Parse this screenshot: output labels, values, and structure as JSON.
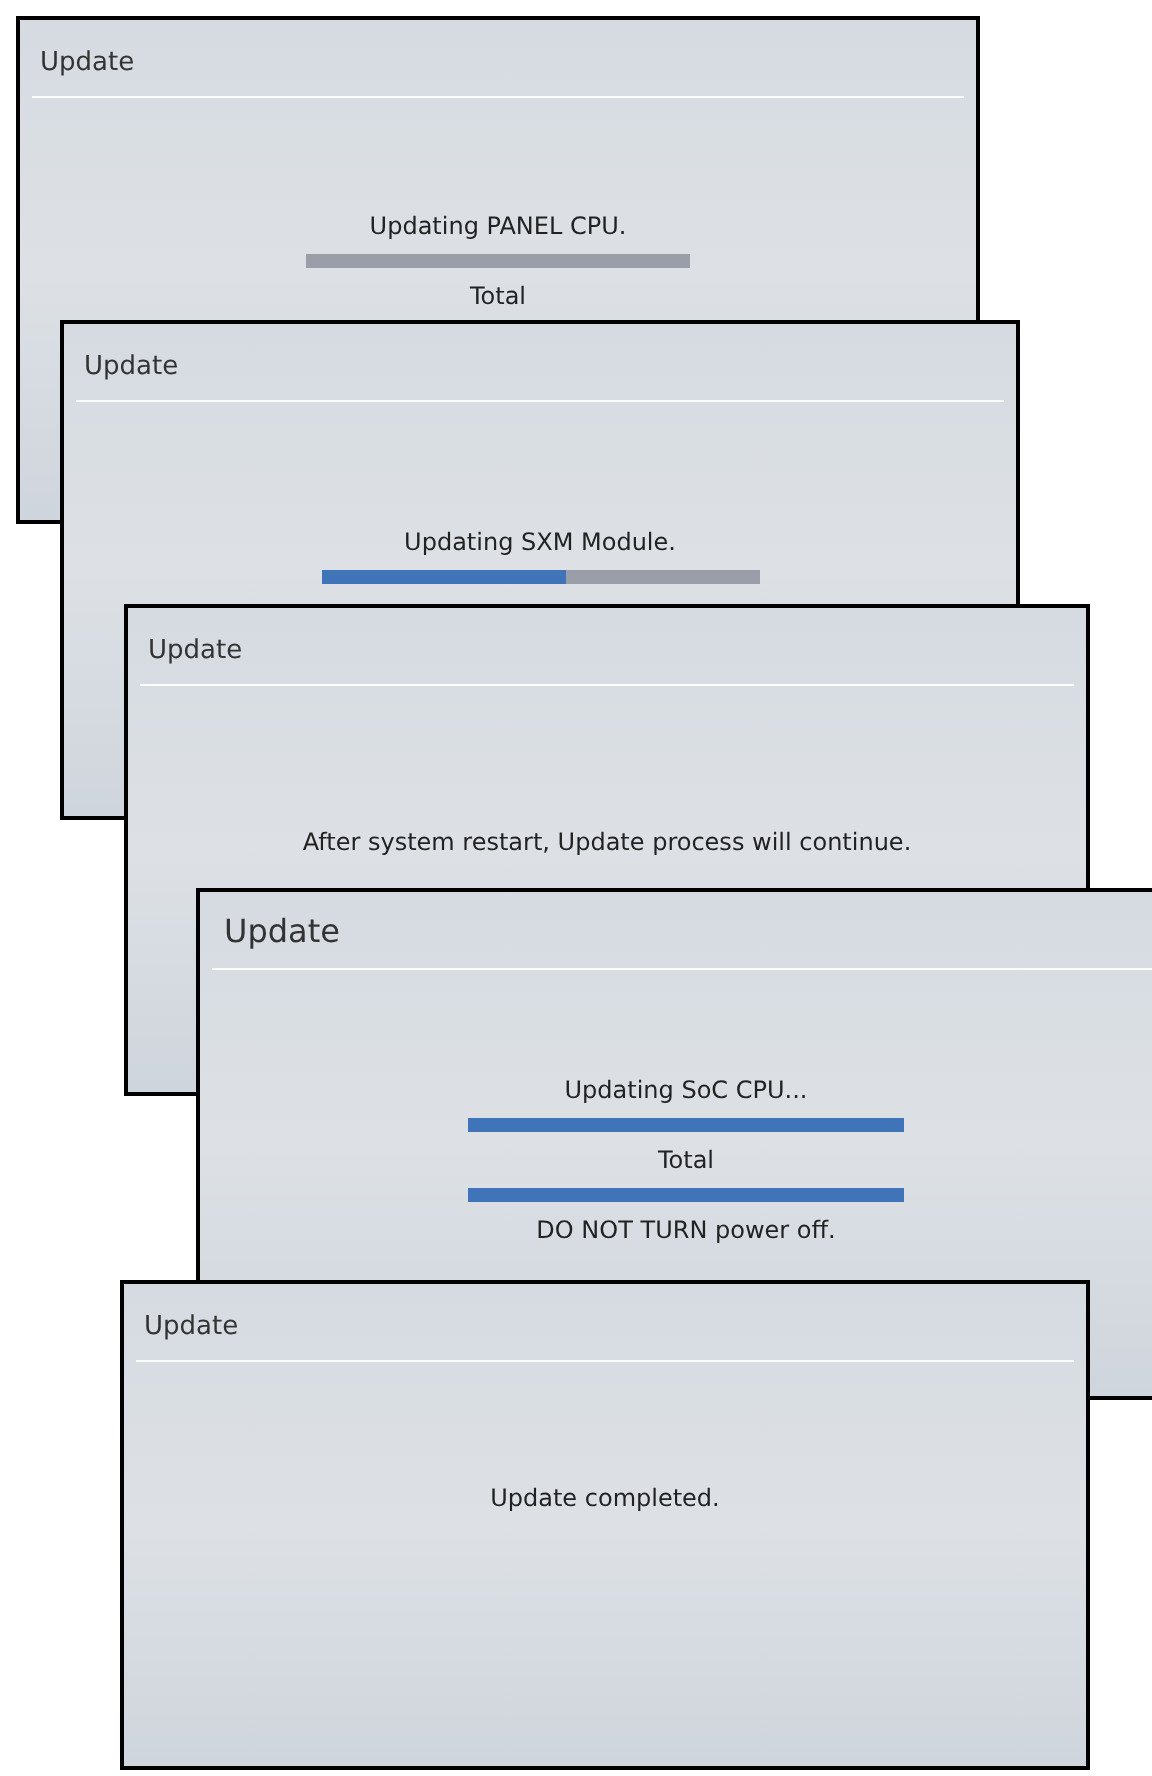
{
  "screens": [
    {
      "title": "Update",
      "items": [
        {
          "kind": "text",
          "text": "Updating PANEL CPU."
        },
        {
          "kind": "progress",
          "level": 0
        },
        {
          "kind": "text",
          "text": "Total"
        }
      ]
    },
    {
      "title": "Update",
      "items": [
        {
          "kind": "text",
          "text": "Updating SXM Module."
        },
        {
          "kind": "progress",
          "level": 0.56
        }
      ]
    },
    {
      "title": "Update",
      "items": [
        {
          "kind": "text",
          "text": "After system restart, Update process will continue."
        }
      ]
    },
    {
      "title": "Update",
      "items": [
        {
          "kind": "text",
          "text": "Updating SoC CPU..."
        },
        {
          "kind": "progress",
          "level": 1
        },
        {
          "kind": "text",
          "text": "Total"
        },
        {
          "kind": "progress",
          "level": 1
        },
        {
          "kind": "text",
          "text": "DO NOT TURN power off."
        }
      ]
    },
    {
      "title": "Update",
      "items": [
        {
          "kind": "text",
          "text": "Update completed."
        }
      ]
    }
  ]
}
